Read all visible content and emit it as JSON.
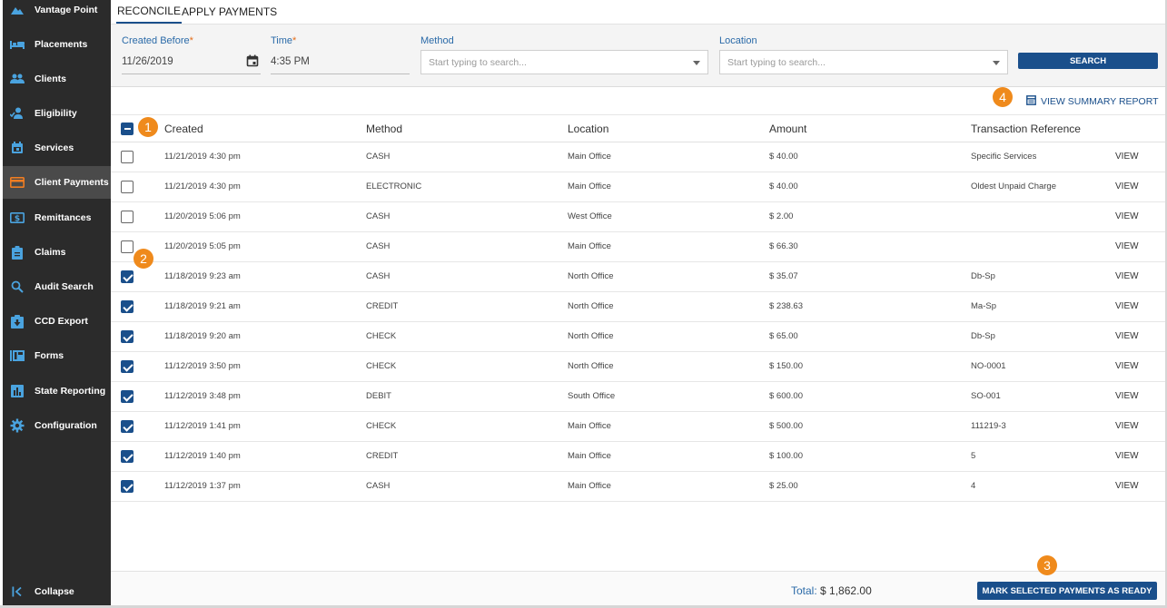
{
  "sidebar": {
    "items": [
      {
        "label": "Vantage Point",
        "icon": "mountain-icon"
      },
      {
        "label": "Placements",
        "icon": "bed-icon"
      },
      {
        "label": "Clients",
        "icon": "people-icon"
      },
      {
        "label": "Eligibility",
        "icon": "person-check-icon"
      },
      {
        "label": "Services",
        "icon": "calendar-icon"
      },
      {
        "label": "Client Payments",
        "icon": "credit-card-icon"
      },
      {
        "label": "Remittances",
        "icon": "dollar-icon"
      },
      {
        "label": "Claims",
        "icon": "clipboard-icon"
      },
      {
        "label": "Audit Search",
        "icon": "search-icon"
      },
      {
        "label": "CCD Export",
        "icon": "export-icon"
      },
      {
        "label": "Forms",
        "icon": "forms-icon"
      },
      {
        "label": "State Reporting",
        "icon": "bar-chart-icon"
      },
      {
        "label": "Configuration",
        "icon": "gear-icon"
      }
    ],
    "collapse_label": "Collapse",
    "active_item": "Client Payments"
  },
  "tabs": [
    {
      "label": "RECONCILE",
      "active": true
    },
    {
      "label": "APPLY PAYMENTS",
      "active": false
    }
  ],
  "filters": {
    "created_before_label": "Created Before",
    "created_before_value": "11/26/2019",
    "time_label": "Time",
    "time_value": "4:35 PM",
    "required_mark": "*",
    "method_label": "Method",
    "method_placeholder": "Start typing to search...",
    "location_label": "Location",
    "location_placeholder": "Start typing to search...",
    "search_button": "SEARCH"
  },
  "summary_link": "VIEW SUMMARY REPORT",
  "table": {
    "headers": [
      "Created",
      "Method",
      "Location",
      "Amount",
      "Transaction Reference"
    ],
    "view_label": "VIEW",
    "rows": [
      {
        "checked": false,
        "created": "11/21/2019 4:30 pm",
        "method": "CASH",
        "location": "Main Office",
        "amount": "$ 40.00",
        "reference": "Specific Services"
      },
      {
        "checked": false,
        "created": "11/21/2019 4:30 pm",
        "method": "ELECTRONIC",
        "location": "Main Office",
        "amount": "$ 40.00",
        "reference": "Oldest Unpaid Charge"
      },
      {
        "checked": false,
        "created": "11/20/2019 5:06 pm",
        "method": "CASH",
        "location": "West Office",
        "amount": "$ 2.00",
        "reference": ""
      },
      {
        "checked": false,
        "created": "11/20/2019 5:05 pm",
        "method": "CASH",
        "location": "Main Office",
        "amount": "$ 66.30",
        "reference": ""
      },
      {
        "checked": true,
        "created": "11/18/2019 9:23 am",
        "method": "CASH",
        "location": "North Office",
        "amount": "$ 35.07",
        "reference": "Db-Sp"
      },
      {
        "checked": true,
        "created": "11/18/2019 9:21 am",
        "method": "CREDIT",
        "location": "North Office",
        "amount": "$ 238.63",
        "reference": "Ma-Sp"
      },
      {
        "checked": true,
        "created": "11/18/2019 9:20 am",
        "method": "CHECK",
        "location": "North Office",
        "amount": "$ 65.00",
        "reference": "Db-Sp"
      },
      {
        "checked": true,
        "created": "11/12/2019 3:50 pm",
        "method": "CHECK",
        "location": "North Office",
        "amount": "$ 150.00",
        "reference": "NO-0001"
      },
      {
        "checked": true,
        "created": "11/12/2019 3:48 pm",
        "method": "DEBIT",
        "location": "South Office",
        "amount": "$ 600.00",
        "reference": "SO-001"
      },
      {
        "checked": true,
        "created": "11/12/2019 1:41 pm",
        "method": "CHECK",
        "location": "Main Office",
        "amount": "$ 500.00",
        "reference": "111219-3"
      },
      {
        "checked": true,
        "created": "11/12/2019 1:40 pm",
        "method": "CREDIT",
        "location": "Main Office",
        "amount": "$ 100.00",
        "reference": "5"
      },
      {
        "checked": true,
        "created": "11/12/2019 1:37 pm",
        "method": "CASH",
        "location": "Main Office",
        "amount": "$ 25.00",
        "reference": "4"
      }
    ]
  },
  "footer": {
    "total_label": "Total:",
    "total_value": "$ 1,862.00",
    "mark_button": "MARK SELECTED PAYMENTS AS READY"
  },
  "callouts": [
    "1",
    "2",
    "3",
    "4"
  ],
  "colors": {
    "sidebar_bg": "#2b2b2b",
    "accent": "#1a4f8b",
    "active_icon": "#ef7d22",
    "icon_blue": "#4aa3df",
    "callout": "#ef8a1c"
  }
}
